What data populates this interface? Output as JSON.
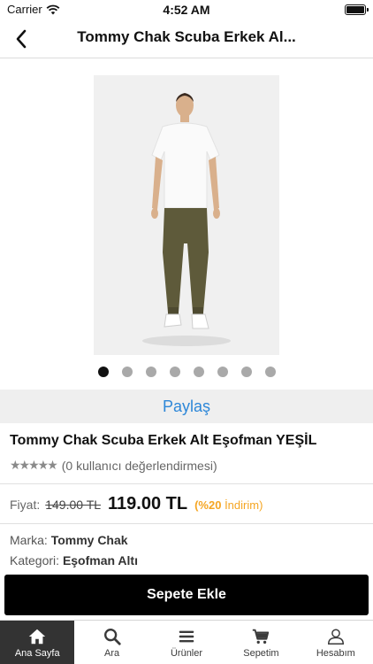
{
  "status_bar": {
    "carrier": "Carrier",
    "time": "4:52 AM"
  },
  "nav": {
    "title": "Tommy Chak Scuba Erkek Al..."
  },
  "gallery": {
    "image_count": 8,
    "active_index": 0
  },
  "share": {
    "label": "Paylaş",
    "color": "#2d87d8"
  },
  "product": {
    "name": "Tommy Chak Scuba Erkek Alt Eşofman YEŞİL",
    "stars": "★★★★★",
    "rating_text": "(0 kullanıcı değerlendirmesi)",
    "price_label": "Fiyat:",
    "old_price": "149.00 TL",
    "new_price": "119.00 TL",
    "discount_percent": "(%20",
    "discount_text": " İndirim)",
    "discount_color": "#f5a623",
    "brand_label": "Marka:",
    "brand": "Tommy Chak",
    "category_label": "Kategori:",
    "category": "Eşofman Altı"
  },
  "add_to_cart": {
    "label": "Sepete Ekle"
  },
  "tabbar": {
    "items": [
      {
        "label": "Ana Sayfa",
        "icon": "home-icon",
        "active": true
      },
      {
        "label": "Ara",
        "icon": "search-icon",
        "active": false
      },
      {
        "label": "Ürünler",
        "icon": "menu-icon",
        "active": false
      },
      {
        "label": "Sepetim",
        "icon": "cart-icon",
        "active": false
      },
      {
        "label": "Hesabım",
        "icon": "user-icon",
        "active": false
      }
    ]
  }
}
